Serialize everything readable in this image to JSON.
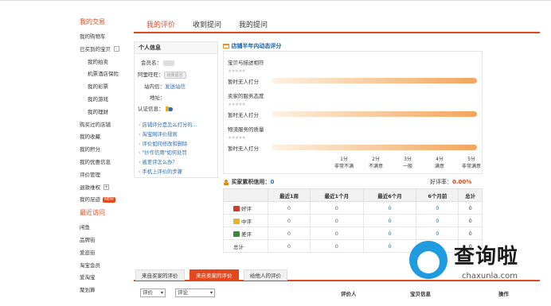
{
  "sidebar": {
    "sections": [
      {
        "title": "我的交易",
        "items": [
          {
            "label": "我的购物车",
            "sub": false
          },
          {
            "label": "已买到的宝贝",
            "sub": false,
            "toggle": "-"
          },
          {
            "label": "我的拍卖",
            "sub": true
          },
          {
            "label": "机票酒店保险",
            "sub": true
          },
          {
            "label": "我的彩票",
            "sub": true
          },
          {
            "label": "我的游戏",
            "sub": true
          },
          {
            "label": "我的理财",
            "sub": true
          },
          {
            "label": "购买过的店铺",
            "sub": false
          },
          {
            "label": "我的收藏",
            "sub": false
          },
          {
            "label": "我的积分",
            "sub": false
          },
          {
            "label": "我的优惠信息",
            "sub": false
          },
          {
            "label": "评价管理",
            "sub": false
          },
          {
            "label": "退款维权",
            "sub": false,
            "toggle": "+"
          },
          {
            "label": "我的足迹",
            "sub": false,
            "new": "NEW"
          }
        ]
      },
      {
        "title": "最近访问",
        "items": [
          {
            "label": "闲鱼",
            "sub": false
          },
          {
            "label": "品牌街",
            "sub": false
          },
          {
            "label": "爱逛街",
            "sub": false
          },
          {
            "label": "淘宝会员",
            "sub": false
          },
          {
            "label": "爱淘宝",
            "sub": false
          },
          {
            "label": "聚划算",
            "sub": false
          }
        ]
      }
    ]
  },
  "tabs": [
    "我的评价",
    "收到提问",
    "我的提问"
  ],
  "info": {
    "title": "个人信息",
    "member_label": "会员名：",
    "wangwang_label": "阿里旺旺：",
    "wangwang_btn": "给我留言",
    "site_msg_label": "站内信：",
    "site_msg_link": "发送站信",
    "address_label": "地址：",
    "cert_label": "认证信息："
  },
  "faq": [
    "店铺评分是怎么打分的…",
    "淘宝网评价规则",
    "评价如何修改和删除",
    "\"炒作信用\"如何处罚",
    "被差评怎么办？",
    "手机上评价的步骤"
  ],
  "dynamic": {
    "title": "店铺半年内动态评分",
    "items": [
      {
        "label": "宝贝与描述相符",
        "status": "暂时无人打分"
      },
      {
        "label": "卖家的服务态度",
        "status": "暂时无人打分"
      },
      {
        "label": "物流服务的质量",
        "status": "暂时无人打分"
      }
    ],
    "scale": [
      {
        "score": "1分",
        "desc": "非常不满"
      },
      {
        "score": "2分",
        "desc": "不满意"
      },
      {
        "score": "3分",
        "desc": "一般"
      },
      {
        "score": "4分",
        "desc": "满意"
      },
      {
        "score": "5分",
        "desc": "非常满意"
      }
    ]
  },
  "credit": {
    "title": "买家累积信用：",
    "value": "0",
    "good_rate_label": "好评率：",
    "good_rate": "0.00%",
    "columns": [
      "",
      "最近1周",
      "最近1个月",
      "最近6个月",
      "6个月前",
      "总计"
    ],
    "rows": [
      {
        "label": "好评",
        "icon": "red",
        "values": [
          "0",
          "0",
          "0",
          "0",
          "0"
        ]
      },
      {
        "label": "中评",
        "icon": "yellow",
        "values": [
          "0",
          "0",
          "0",
          "0",
          "0"
        ]
      },
      {
        "label": "差评",
        "icon": "green",
        "values": [
          "0",
          "0",
          "0",
          "0",
          "0"
        ]
      },
      {
        "label": "总计",
        "icon": "",
        "values": [
          "0",
          "0",
          "0",
          "0",
          "0"
        ]
      }
    ]
  },
  "bottom_tabs": [
    "来自买家的评价",
    "来自卖家的评价",
    "给他人的评价"
  ],
  "filters": {
    "select1": "评价",
    "select2": "评论"
  },
  "list_headers": {
    "evaluator": "评价人",
    "item_info": "宝贝信息",
    "action": "操作"
  },
  "watermark": {
    "text": "查询啦",
    "url": "chaxunla.com"
  }
}
